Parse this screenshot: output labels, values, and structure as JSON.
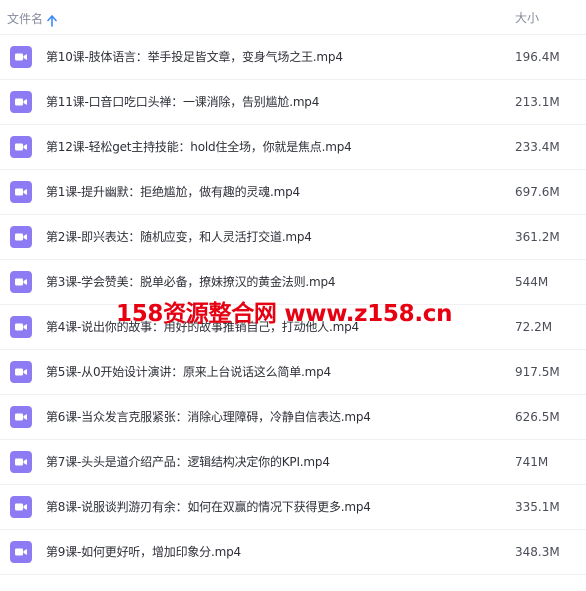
{
  "header": {
    "name_label": "文件名",
    "size_label": "大小",
    "sort_direction": "ascending"
  },
  "colors": {
    "file_icon": "#8c7bf3",
    "sort_arrow": "#3d8af7",
    "watermark": "#e60012"
  },
  "files": [
    {
      "name": "第10课-肢体语言：举手投足皆文章，变身气场之王.mp4",
      "size": "196.4M",
      "icon": "video-file-icon"
    },
    {
      "name": "第11课-口音口吃口头禅：一课消除，告别尴尬.mp4",
      "size": "213.1M",
      "icon": "video-file-icon"
    },
    {
      "name": "第12课-轻松get主持技能：hold住全场，你就是焦点.mp4",
      "size": "233.4M",
      "icon": "video-file-icon"
    },
    {
      "name": "第1课-提升幽默：拒绝尴尬，做有趣的灵魂.mp4",
      "size": "697.6M",
      "icon": "video-file-icon"
    },
    {
      "name": "第2课-即兴表达：随机应变，和人灵活打交道.mp4",
      "size": "361.2M",
      "icon": "video-file-icon"
    },
    {
      "name": "第3课-学会赞美：脱单必备，撩妹撩汉的黄金法则.mp4",
      "size": "544M",
      "icon": "video-file-icon"
    },
    {
      "name": "第4课-说出你的故事：用好的故事推销自己，打动他人.mp4",
      "size": "72.2M",
      "icon": "video-file-icon"
    },
    {
      "name": "第5课-从0开始设计演讲：原来上台说话这么简单.mp4",
      "size": "917.5M",
      "icon": "video-file-icon"
    },
    {
      "name": "第6课-当众发言克服紧张：消除心理障碍，冷静自信表达.mp4",
      "size": "626.5M",
      "icon": "video-file-icon"
    },
    {
      "name": "第7课-头头是道介绍产品：逻辑结构决定你的KPI.mp4",
      "size": "741M",
      "icon": "video-file-icon"
    },
    {
      "name": "第8课-说服谈判游刃有余：如何在双赢的情况下获得更多.mp4",
      "size": "335.1M",
      "icon": "video-file-icon"
    },
    {
      "name": "第9课-如何更好听，增加印象分.mp4",
      "size": "348.3M",
      "icon": "video-file-icon"
    }
  ],
  "watermark": {
    "text": "158资源整合网 www.z158.cn"
  }
}
